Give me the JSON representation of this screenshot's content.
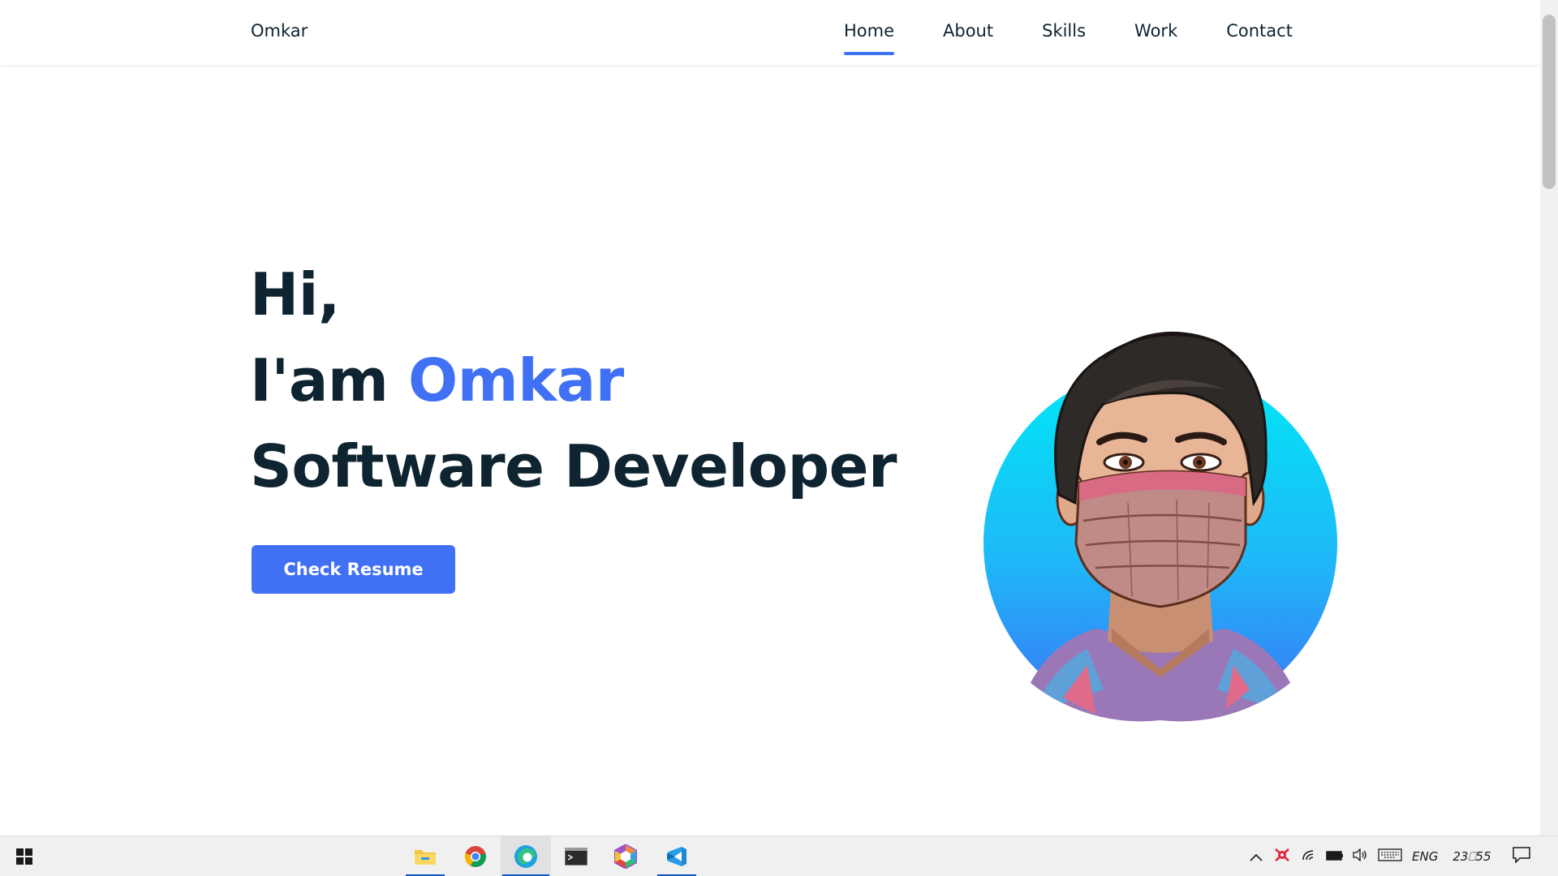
{
  "brand": {
    "name": "Omkar"
  },
  "nav": {
    "items": [
      {
        "label": "Home",
        "active": true
      },
      {
        "label": "About",
        "active": false
      },
      {
        "label": "Skills",
        "active": false
      },
      {
        "label": "Work",
        "active": false
      },
      {
        "label": "Contact",
        "active": false
      }
    ]
  },
  "hero": {
    "greeting": "Hi,",
    "intro_prefix": "I'am ",
    "intro_name": "Omkar",
    "role": "Software Developer",
    "cta_label": "Check Resume"
  },
  "colors": {
    "accent": "#4070f4",
    "text_dark": "#0e2431",
    "avatar_gradient_top": "#00e8f5",
    "avatar_gradient_bottom": "#2e86f7"
  },
  "taskbar": {
    "apps": [
      {
        "name": "file-explorer-icon",
        "running": true
      },
      {
        "name": "chrome-icon",
        "running": false
      },
      {
        "name": "edge-icon",
        "running": true
      },
      {
        "name": "terminal-icon",
        "running": false
      },
      {
        "name": "hexagon-app-icon",
        "running": false
      },
      {
        "name": "vscode-icon",
        "running": true
      }
    ],
    "tray": {
      "language": "ENG",
      "clock": "23⎕55"
    }
  }
}
